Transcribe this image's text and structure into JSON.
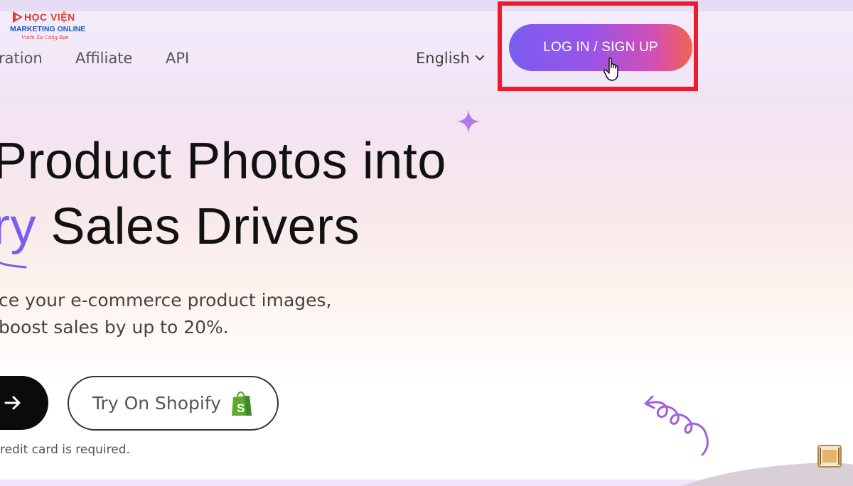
{
  "logo": {
    "line1": "HỌC VIỆN",
    "line2": "MARKETING ONLINE",
    "line3": "Vươn Xa Cùng Bạn"
  },
  "nav": {
    "items": [
      {
        "label": "ration"
      },
      {
        "label": "Affiliate"
      },
      {
        "label": "API"
      }
    ],
    "language": "English",
    "login_label": "LOG IN / SIGN UP"
  },
  "hero": {
    "title_line1": "Product Photos into",
    "title_line2_accent": "ry",
    "title_line2_rest": " Sales Drivers",
    "subtitle_line1": "ce your e-commerce product images,",
    "subtitle_line2": "boost sales by up to 20%.",
    "shopify_button": "Try On Shopify",
    "note": "redit card is required."
  },
  "colors": {
    "accent": "#7a5cf0",
    "highlight": "#ef1a2c",
    "gradient_start": "#7b5cf0",
    "gradient_end": "#f2644f"
  },
  "icons": [
    "chevron-down-icon",
    "hand-pointer-icon",
    "sparkle-icon",
    "arrow-right-icon",
    "shopify-bag-icon",
    "loop-arrow-icon"
  ]
}
